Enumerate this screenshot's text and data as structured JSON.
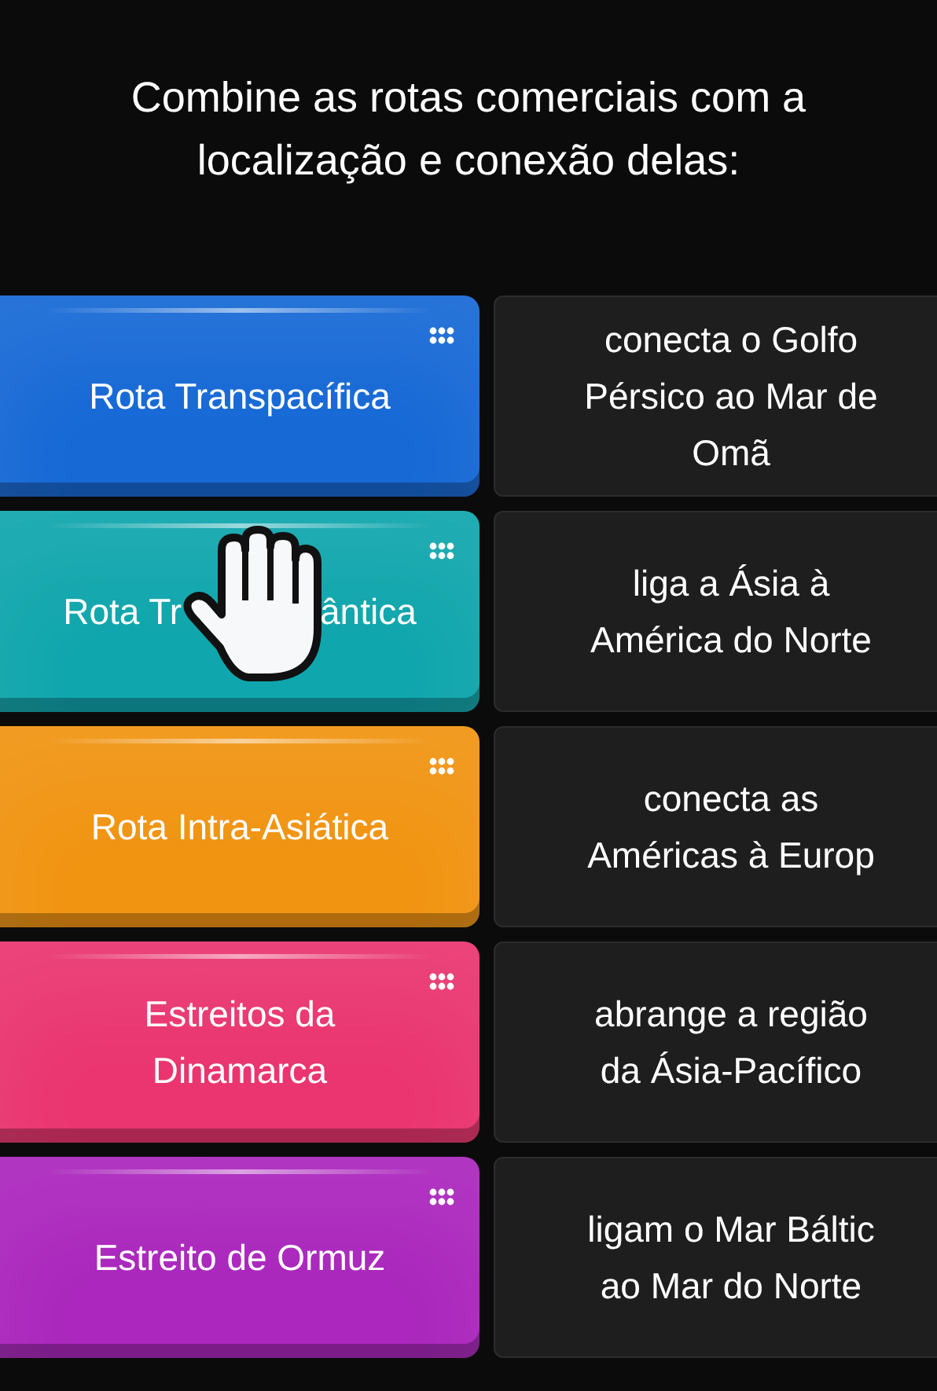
{
  "title": "Combine as rotas comerciais com a localização e conexão delas:",
  "pairs": [
    {
      "route": {
        "lines": [
          "Rota Transpacífica"
        ],
        "color": "#1769d6",
        "cursor": false
      },
      "description": [
        "conecta o Golfo",
        "Pérsico ao Mar de",
        "Omã"
      ]
    },
    {
      "route": {
        "lines": [
          "Rota Tr",
          "ântica"
        ],
        "color": "#10a6ad",
        "cursor": true
      },
      "description": [
        "liga a Ásia à",
        "América do Norte"
      ]
    },
    {
      "route": {
        "lines": [
          "Rota Intra-Asiática"
        ],
        "color": "#f19412",
        "cursor": false
      },
      "description": [
        "conecta as",
        "Américas à Europ"
      ]
    },
    {
      "route": {
        "lines": [
          "Estreitos da",
          "Dinamarca"
        ],
        "color": "#ea3570",
        "cursor": false
      },
      "description": [
        "abrange a região",
        "da Ásia-Pacífico"
      ]
    },
    {
      "route": {
        "lines": [
          "Estreito de Ormuz"
        ],
        "color": "#ab27bd",
        "cursor": false
      },
      "description": [
        "ligam o Mar Báltic",
        "ao Mar do Norte"
      ]
    }
  ]
}
